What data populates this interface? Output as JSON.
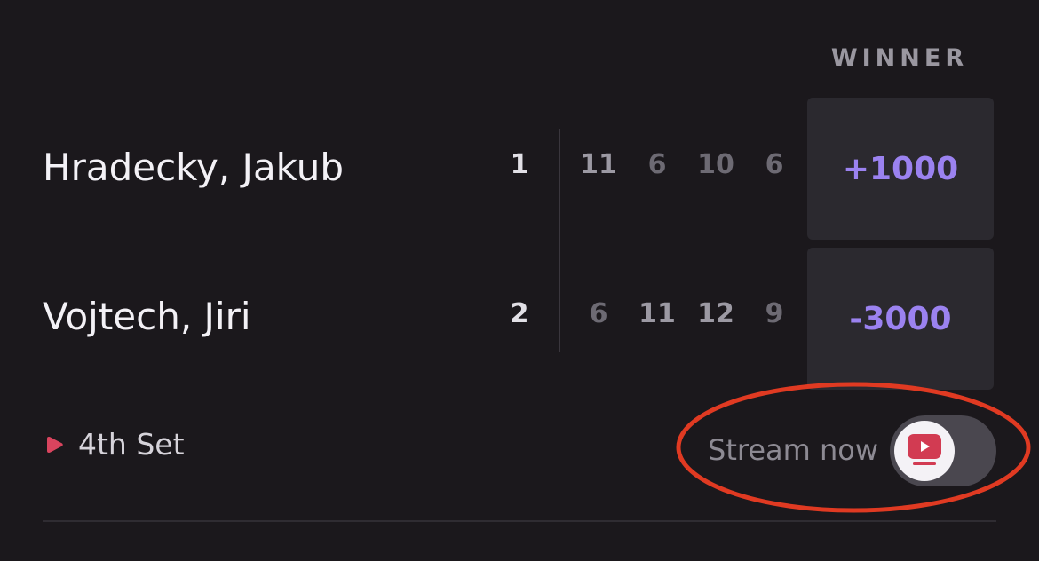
{
  "market": {
    "header": "WINNER"
  },
  "players": [
    {
      "name": "Hradecky, Jakub",
      "sets": "1",
      "games": [
        "11",
        "6",
        "10",
        "6"
      ],
      "odds": "+1000"
    },
    {
      "name": "Vojtech, Jiri",
      "sets": "2",
      "games": [
        "6",
        "11",
        "12",
        "9"
      ],
      "odds": "-3000"
    }
  ],
  "status": {
    "label": "4th Set",
    "icon": "live-play-icon"
  },
  "stream": {
    "label": "Stream now",
    "icon": "tv-play-icon",
    "toggle_on": true
  },
  "colors": {
    "background": "#1b181c",
    "odds": "#9b82f0",
    "live": "#d9445e",
    "annotation": "#e03a22"
  }
}
